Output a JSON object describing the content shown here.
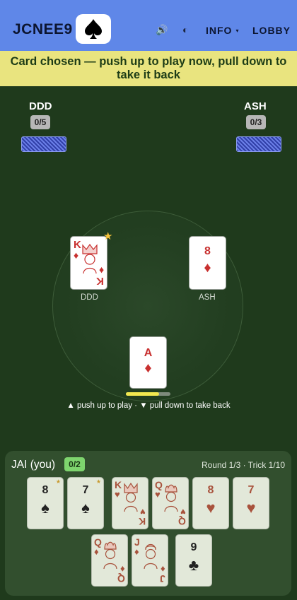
{
  "header": {
    "title": "JCNEE9",
    "logo_icon": "spade-icon",
    "sound_glyph": "🔊",
    "contrast_glyph": "◐",
    "info_label": "INFO",
    "info_caret": "▾",
    "lobby_label": "LOBBY"
  },
  "banner": {
    "text": "Card chosen — push up to play now, pull down to take it back"
  },
  "opponents": [
    {
      "name": "DDD",
      "score": "0/5"
    },
    {
      "name": "ASH",
      "score": "0/3"
    }
  ],
  "trick": {
    "ddd_card": {
      "rank": "K",
      "suit": "♦",
      "color": "red",
      "label": "DDD",
      "leading_star": "★"
    },
    "ash_card": {
      "rank": "8",
      "suit": "♦",
      "color": "red",
      "label": "ASH"
    },
    "chosen_card": {
      "rank": "A",
      "suit": "♦",
      "color": "red"
    },
    "progress": 0.75,
    "hint": "▲ push up to play · ▼ pull down to take back"
  },
  "player": {
    "name": "JAI (you)",
    "score": "0/2",
    "round_info": "Round 1/3 · Trick 1/10"
  },
  "hand": [
    {
      "rank": "8",
      "suit": "♠",
      "color": "black",
      "star": "★"
    },
    {
      "rank": "7",
      "suit": "♠",
      "color": "black",
      "star": "★"
    },
    {
      "rank": "K",
      "suit": "♥",
      "color": "red",
      "face": true
    },
    {
      "rank": "Q",
      "suit": "♥",
      "color": "red",
      "face": true
    },
    {
      "rank": "8",
      "suit": "♥",
      "color": "red"
    },
    {
      "rank": "7",
      "suit": "♥",
      "color": "red"
    },
    {
      "rank": "Q",
      "suit": "♦",
      "color": "red",
      "face": true
    },
    {
      "rank": "J",
      "suit": "♦",
      "color": "red",
      "face": true
    },
    {
      "rank": "9",
      "suit": "♣",
      "color": "black"
    }
  ],
  "colors": {
    "header": "#5f87e8",
    "banner": "#e9e47f",
    "felt": "#1f3a1c",
    "panel": "#324f2e"
  }
}
